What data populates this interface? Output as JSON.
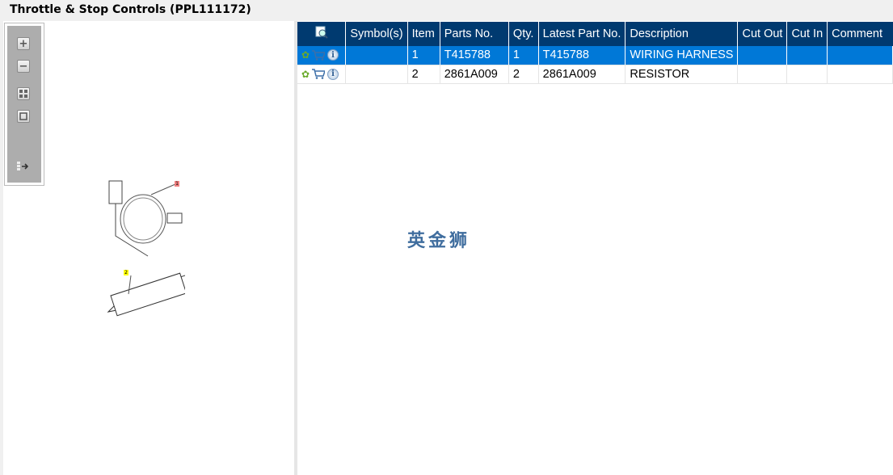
{
  "title": "Throttle & Stop Controls (PPL111172)",
  "toolbar": {
    "items": [
      "zoom-in",
      "zoom-out",
      "fit-all",
      "fit-window",
      "expand-panel"
    ]
  },
  "diagram": {
    "callouts": [
      "1",
      "2"
    ]
  },
  "table": {
    "columns": [
      "",
      "Symbol(s)",
      "Item",
      "Parts No.",
      "Qty.",
      "Latest Part No.",
      "Description",
      "Cut Out",
      "Cut In",
      "Comment"
    ],
    "rows": [
      {
        "symbols": "",
        "item": "1",
        "parts_no": "T415788",
        "qty": "1",
        "latest": "T415788",
        "description": "WIRING HARNESS",
        "cut_out": "",
        "cut_in": "",
        "comment": ""
      },
      {
        "symbols": "",
        "item": "2",
        "parts_no": "2861A009",
        "qty": "2",
        "latest": "2861A009",
        "description": "RESISTOR",
        "cut_out": "",
        "cut_in": "",
        "comment": ""
      }
    ]
  },
  "watermark": "英金狮",
  "colors": {
    "header": "#003a70",
    "selected": "#0078d7"
  }
}
